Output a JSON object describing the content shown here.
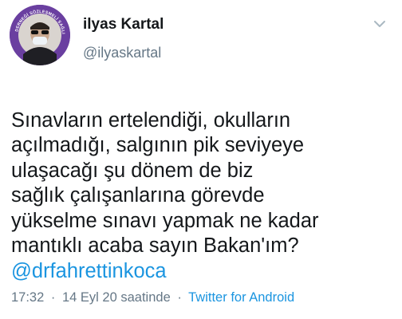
{
  "user": {
    "name": "ilyas Kartal",
    "handle": "@ilyaskartal",
    "avatar_badge_text": "DERNEĞİ SÖZLEŞMELİ SAĞLIK"
  },
  "tweet": {
    "text": "Sınavların ertelendiği, okulların\naçılmadığı, salgının pik seviyeye\nulaşacağı şu dönem de biz\nsağlık çalışanlarına görevde\nyükselme sınavı yapmak ne kadar\nmantıklı acaba sayın Bakan'ım?",
    "mention": "@drfahrettinkoca"
  },
  "meta": {
    "time": "17:32",
    "separator": "·",
    "date_text": "14 Eyl 20 saatinde",
    "client": "Twitter for Android"
  },
  "icons": {
    "menu": "chevron-down-icon"
  },
  "colors": {
    "link": "#1b95e0",
    "secondary_text": "#657786",
    "avatar_ring": "#6a3fa0"
  }
}
